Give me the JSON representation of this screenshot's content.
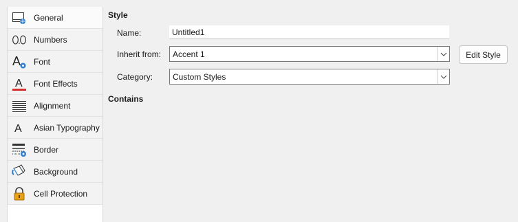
{
  "sidebar": {
    "items": [
      {
        "label": "General",
        "icon": "general-icon"
      },
      {
        "label": "Numbers",
        "icon": "numbers-icon"
      },
      {
        "label": "Font",
        "icon": "font-icon"
      },
      {
        "label": "Font Effects",
        "icon": "font-effects-icon"
      },
      {
        "label": "Alignment",
        "icon": "alignment-icon"
      },
      {
        "label": "Asian Typography",
        "icon": "asian-typography-icon"
      },
      {
        "label": "Border",
        "icon": "border-icon"
      },
      {
        "label": "Background",
        "icon": "background-icon"
      },
      {
        "label": "Cell Protection",
        "icon": "cell-protection-icon"
      }
    ],
    "selected": "General"
  },
  "style_section": {
    "title": "Style",
    "name_label": "Name:",
    "name_value": "Untitled1",
    "inherit_label": "Inherit from:",
    "inherit_value": "Accent 1",
    "edit_style_label": "Edit Style",
    "category_label": "Category:",
    "category_value": "Custom Styles"
  },
  "contains_section": {
    "title": "Contains"
  },
  "colors": {
    "accent_blue": "#2f7fd0",
    "font_effects_red": "#d32f2f",
    "lock_orange": "#e7a21a"
  }
}
